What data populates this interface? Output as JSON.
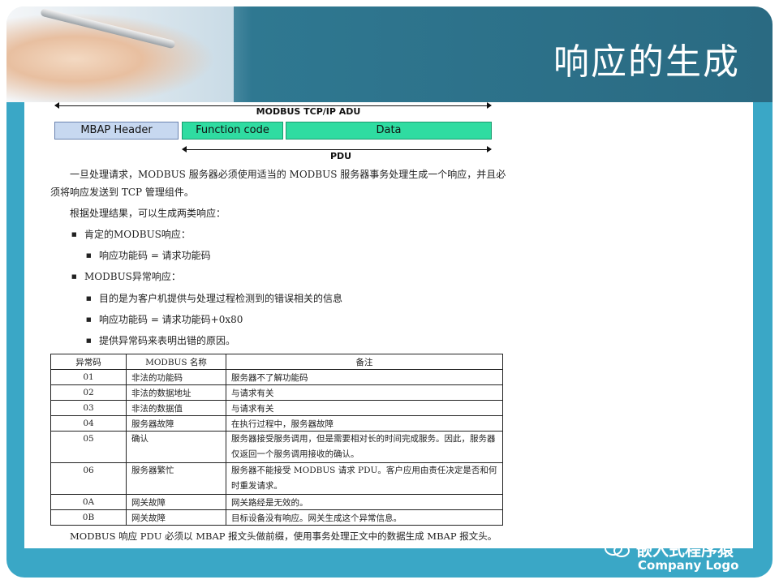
{
  "slide": {
    "title": "响应的生成"
  },
  "diagram": {
    "adu_label": "MODBUS TCP/IP ADU",
    "mbap": "MBAP Header",
    "function_code": "Function code",
    "data": "Data",
    "pdu_label": "PDU"
  },
  "text": {
    "intro_line1": "一旦处理请求，MODBUS 服务器必须使用适当的 MODBUS 服务器事务处理生成一个响应，并且必",
    "intro_line2": "须将响应发送到 TCP 管理组件。",
    "kinds": "根据处理结果，可以生成两类响应：",
    "positive": "肯定的MODBUS响应：",
    "positive_sub": "响应功能码 = 请求功能码",
    "exception": "MODBUS异常响应：",
    "exception_sub1": "目的是为客户机提供与处理过程检测到的错误相关的信息",
    "exception_sub2": "响应功能码 = 请求功能码+0x80",
    "exception_sub3": "提供异常码来表明出错的原因。"
  },
  "table": {
    "headers": [
      "异常码",
      "MODBUS 名称",
      "备注"
    ],
    "rows": [
      [
        "01",
        "非法的功能码",
        "服务器不了解功能码"
      ],
      [
        "02",
        "非法的数据地址",
        "与请求有关"
      ],
      [
        "03",
        "非法的数据值",
        "与请求有关"
      ],
      [
        "04",
        "服务器故障",
        "在执行过程中，服务器故障"
      ],
      [
        "05",
        "确认",
        "服务器接受服务调用，但是需要相对长的时间完成服务。因此，服务器仅返回一个服务调用接收的确认。"
      ],
      [
        "06",
        "服务器繁忙",
        "服务器不能接受 MODBUS 请求 PDU。客户应用由责任决定是否和何时重发请求。"
      ],
      [
        "0A",
        "网关故障",
        "网关路经是无效的。"
      ],
      [
        "0B",
        "网关故障",
        "目标设备没有响应。网关生成这个异常信息。"
      ]
    ]
  },
  "footnote": "MODBUS 响应 PDU 必须以 MBAP 报文头做前缀，使用事务处理正文中的数据生成 MBAP 报文头。",
  "watermark": {
    "account": "嵌入式程序猿",
    "logo": "Company Logo"
  },
  "colors": {
    "banner": "#2a6a82",
    "frame": "#3aa7c6",
    "pdu_box": "#2fdca1",
    "mbap_box": "#c7d8f0"
  }
}
